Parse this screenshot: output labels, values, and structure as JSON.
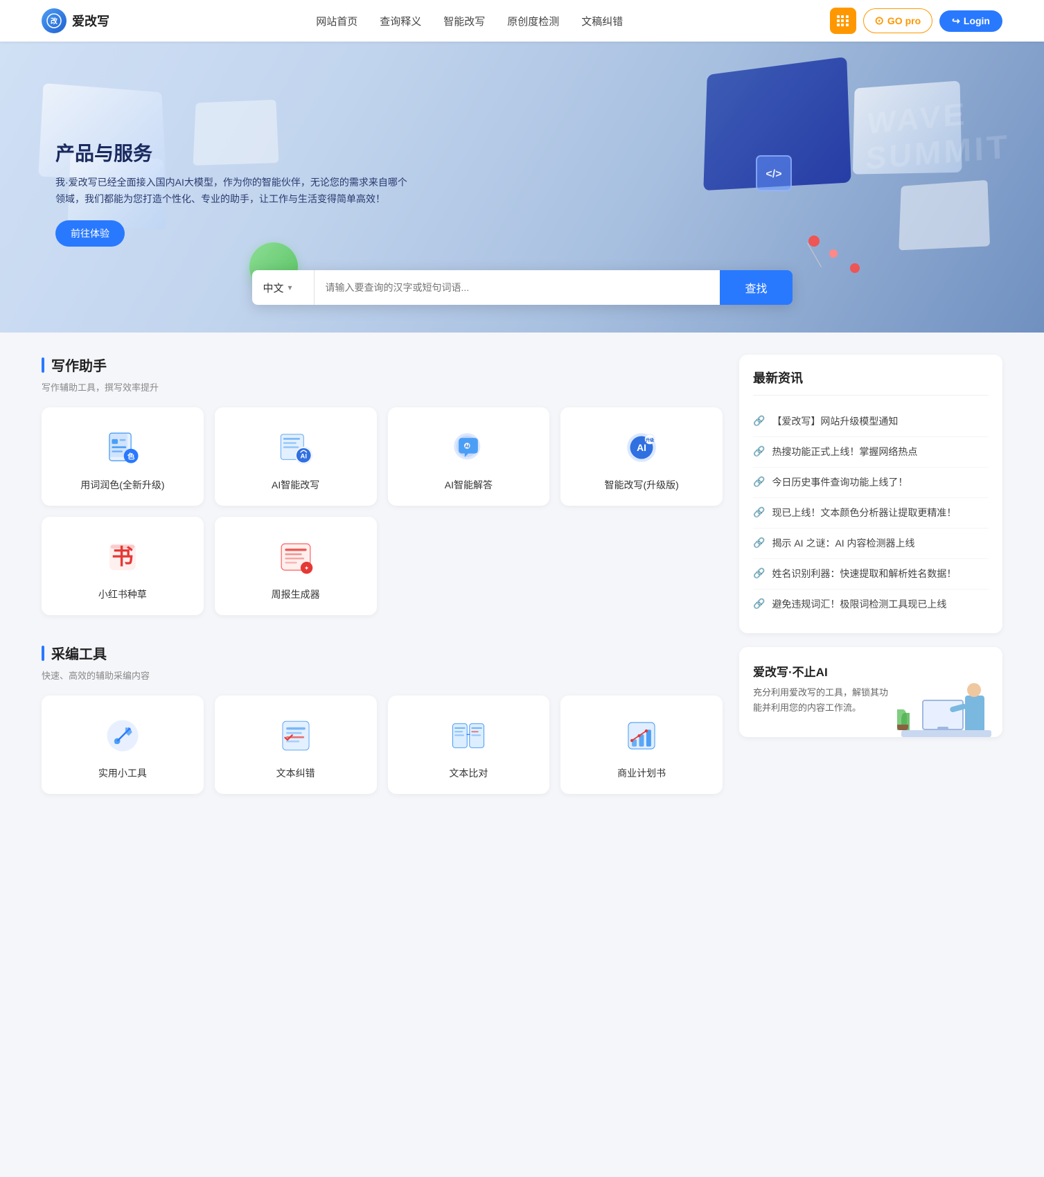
{
  "navbar": {
    "logo_icon": "改",
    "logo_text": "爱改写",
    "links": [
      {
        "label": "网站首页",
        "id": "home"
      },
      {
        "label": "查询释义",
        "id": "query"
      },
      {
        "label": "智能改写",
        "id": "rewrite"
      },
      {
        "label": "原创度检测",
        "id": "originality"
      },
      {
        "label": "文稿纠错",
        "id": "proofread"
      }
    ],
    "btn_grid_label": "⠿",
    "btn_go_label": "GO pro",
    "btn_login_label": "Login"
  },
  "hero": {
    "title": "产品与服务",
    "description": "我·爱改写已经全面接入国内AI大模型，作为你的智能伙伴，无论您的需求来自哪个领域，我们都能为您打造个性化、专业的助手，让工作与生活变得简单高效！",
    "cta_label": "前往体验"
  },
  "search": {
    "lang_label": "中文",
    "placeholder": "请输入要查询的汉字或短句词语...",
    "btn_label": "查找"
  },
  "writing_tools": {
    "section_title": "写作助手",
    "section_subtitle": "写作辅助工具，撰写效率提升",
    "tools": [
      {
        "id": "word-color",
        "label": "用词润色(全新升级)",
        "icon": "writing-doc"
      },
      {
        "id": "ai-rewrite",
        "label": "AI智能改写",
        "icon": "ai-rewrite"
      },
      {
        "id": "ai-answer",
        "label": "AI智能解答",
        "icon": "ai-answer"
      },
      {
        "id": "smart-rewrite",
        "label": "智能改写(升级版)",
        "icon": "smart-rewrite"
      },
      {
        "id": "xiaohongshu",
        "label": "小红书种草",
        "icon": "xiaohongshu"
      },
      {
        "id": "weekly-report",
        "label": "周报生成器",
        "icon": "weekly-report"
      }
    ]
  },
  "mining_tools": {
    "section_title": "采编工具",
    "section_subtitle": "快速、高效的辅助采编内容",
    "tools": [
      {
        "id": "practical-tools",
        "label": "实用小工具",
        "icon": "tools-wrench"
      },
      {
        "id": "text-proofread",
        "label": "文本纠错",
        "icon": "text-error"
      },
      {
        "id": "text-compare",
        "label": "文本比对",
        "icon": "text-compare"
      },
      {
        "id": "business-plan",
        "label": "商业计划书",
        "icon": "business-plan"
      }
    ]
  },
  "news": {
    "title": "最新资讯",
    "items": [
      {
        "text": "【爱改写】网站升级模型通知"
      },
      {
        "text": "热搜功能正式上线！掌握网络热点"
      },
      {
        "text": "今日历史事件查询功能上线了！"
      },
      {
        "text": "现已上线！文本颜色分析器让提取更精准！"
      },
      {
        "text": "揭示 AI 之谜：AI 内容检测器上线"
      },
      {
        "text": "姓名识别利器：快速提取和解析姓名数据！"
      },
      {
        "text": "避免违规词汇！极限词检测工具现已上线"
      }
    ]
  },
  "promo": {
    "title": "爱改写·不止AI",
    "text": "充分利用爱改写的工具，解锁其功能并利用您的内容工作流。"
  }
}
